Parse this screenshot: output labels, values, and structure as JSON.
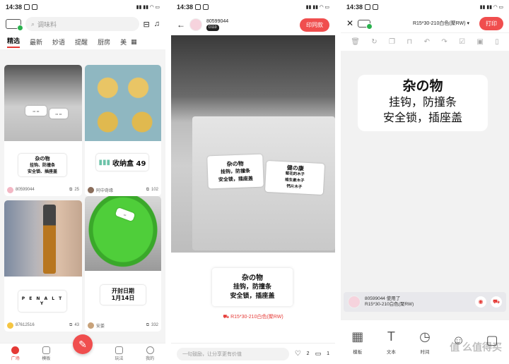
{
  "status": {
    "time": "14:38"
  },
  "p1": {
    "search_placeholder": "调味料",
    "tabs": [
      "精选",
      "最新",
      "妙语",
      "提醒",
      "厨房",
      "美"
    ],
    "cards": [
      {
        "label_lines": [
          "杂の物",
          "挂钩、防撞条",
          "安全锁、插座盖"
        ],
        "user": "80599044",
        "count": "25"
      },
      {
        "label_lines": [
          "收纳盒 49"
        ],
        "user": "阿中奇缘",
        "count": "102"
      },
      {
        "label_lines": [
          "P E N A L T Y"
        ],
        "user": "87612516",
        "count": "43"
      },
      {
        "label_lines": [
          "开封日期",
          "1月14日"
        ],
        "user": "安娄",
        "count": "332"
      }
    ],
    "nav": [
      "广场",
      "模板",
      "",
      "玩法",
      "我的"
    ]
  },
  "p2": {
    "username": "80599044",
    "device": "D110",
    "print_btn": "印同款",
    "label1_lines": [
      "杂の物",
      "挂钩，防撞条",
      "安全锁，插座盖"
    ],
    "label2_lines": [
      "健の康",
      "菊花的木子",
      "维生素木子",
      "钙片木子"
    ],
    "white_label_lines": [
      "杂の物",
      "挂钩，防撞条",
      "安全锁，插座盖"
    ],
    "spec": "R15*30-210白色(聚RW)",
    "comment_placeholder": "一句鼓励，让分享更有价值",
    "likes": "2",
    "comments": "1"
  },
  "p3": {
    "spec_select": "R15*30-210白色(聚RW)",
    "print_btn": "打印",
    "canvas_lines": [
      "杂の物",
      "挂钩，防撞条",
      "安全锁，插座盖"
    ],
    "used_line1": "80599044 使用了",
    "used_line2": "R15*30-210白色(聚RW)",
    "tools": [
      "模板",
      "文本",
      "时间",
      "",
      ""
    ],
    "watermark": "值 么值得买"
  }
}
